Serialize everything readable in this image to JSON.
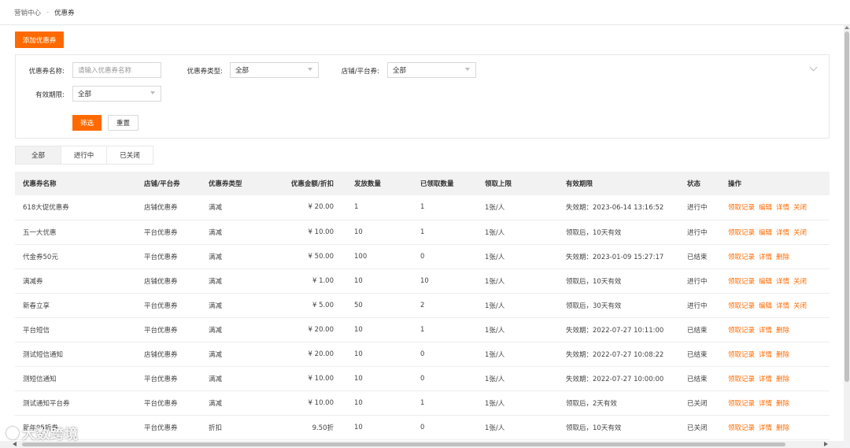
{
  "breadcrumb": {
    "parent": "营销中心",
    "separator": "-",
    "current": "优惠券"
  },
  "toolbar": {
    "add_label": "添加优惠券"
  },
  "filters": {
    "name_label": "优惠券名称:",
    "name_placeholder": "请输入优惠券名称",
    "type_label": "优惠券类型:",
    "type_value": "全部",
    "scope_label": "店铺/平台券:",
    "scope_value": "全部",
    "validity_label": "有效期限:",
    "validity_value": "全部",
    "filter_button": "筛选",
    "reset_button": "重置"
  },
  "tabs": [
    {
      "label": "全部"
    },
    {
      "label": "进行中"
    },
    {
      "label": "已关闭"
    }
  ],
  "table": {
    "headers": [
      "优惠券名称",
      "店铺/平台券",
      "优惠券类型",
      "优惠金额/折扣",
      "发放数量",
      "已领取数量",
      "领取上限",
      "有效期限",
      "状态",
      "操作"
    ],
    "rows": [
      {
        "name": "618大促优惠券",
        "scope": "店铺优惠券",
        "type": "满减",
        "amount": "¥ 20.00",
        "issued": "1",
        "claimed": "1",
        "limit": "1张/人",
        "validity": "失效期：2023-06-14 13:16:52",
        "status": "进行中",
        "ops": [
          "领取记录",
          "编辑",
          "详情",
          "关闭"
        ]
      },
      {
        "name": "五一大优惠",
        "scope": "平台优惠券",
        "type": "满减",
        "amount": "¥ 10.00",
        "issued": "10",
        "claimed": "1",
        "limit": "1张/人",
        "validity": "领取后，10天有效",
        "status": "进行中",
        "ops": [
          "领取记录",
          "编辑",
          "详情",
          "关闭"
        ]
      },
      {
        "name": "代金券50元",
        "scope": "平台优惠券",
        "type": "满减",
        "amount": "¥ 50.00",
        "issued": "100",
        "claimed": "0",
        "limit": "1张/人",
        "validity": "失效期：2023-01-09 15:27:17",
        "status": "已结束",
        "ops": [
          "领取记录",
          "详情",
          "删除"
        ]
      },
      {
        "name": "满减券",
        "scope": "店铺优惠券",
        "type": "满减",
        "amount": "¥ 1.00",
        "issued": "10",
        "claimed": "10",
        "limit": "1张/人",
        "validity": "领取后，10天有效",
        "status": "进行中",
        "ops": [
          "领取记录",
          "编辑",
          "详情",
          "关闭"
        ]
      },
      {
        "name": "新春立享",
        "scope": "平台优惠券",
        "type": "满减",
        "amount": "¥ 5.00",
        "issued": "50",
        "claimed": "2",
        "limit": "1张/人",
        "validity": "领取后，30天有效",
        "status": "进行中",
        "ops": [
          "领取记录",
          "编辑",
          "详情",
          "关闭"
        ]
      },
      {
        "name": "平台短信",
        "scope": "平台优惠券",
        "type": "满减",
        "amount": "¥ 20.00",
        "issued": "10",
        "claimed": "1",
        "limit": "1张/人",
        "validity": "失效期：2022-07-27 10:11:00",
        "status": "已结束",
        "ops": [
          "领取记录",
          "详情",
          "删除"
        ]
      },
      {
        "name": "测试短信通知",
        "scope": "店铺优惠券",
        "type": "满减",
        "amount": "¥ 20.00",
        "issued": "10",
        "claimed": "0",
        "limit": "1张/人",
        "validity": "失效期：2022-07-27 10:08:22",
        "status": "已结束",
        "ops": [
          "领取记录",
          "详情",
          "删除"
        ]
      },
      {
        "name": "测短信通知",
        "scope": "平台优惠券",
        "type": "满减",
        "amount": "¥ 10.00",
        "issued": "10",
        "claimed": "0",
        "limit": "1张/人",
        "validity": "失效期：2022-07-27 10:00:00",
        "status": "已结束",
        "ops": [
          "领取记录",
          "详情",
          "删除"
        ]
      },
      {
        "name": "测试通知平台券",
        "scope": "平台优惠券",
        "type": "满减",
        "amount": "¥ 10.00",
        "issued": "10",
        "claimed": "1",
        "limit": "1张/人",
        "validity": "领取后，2天有效",
        "status": "已关闭",
        "ops": [
          "领取记录",
          "详情",
          "删除"
        ]
      },
      {
        "name": "新年95折券",
        "scope": "平台优惠券",
        "type": "折扣",
        "amount": "9.50折",
        "issued": "10",
        "claimed": "0",
        "limit": "1张/人",
        "validity": "领取后，10天有效",
        "status": "已关闭",
        "ops": [
          "领取记录",
          "详情",
          "删除"
        ]
      }
    ]
  },
  "watermark": {
    "text": "大数跨境"
  },
  "colors": {
    "accent": "#ff6a00",
    "header_bg": "#f2f2f2"
  },
  "icons": {
    "select": "chevron-down-icon",
    "collapse": "chevron-down-icon"
  }
}
